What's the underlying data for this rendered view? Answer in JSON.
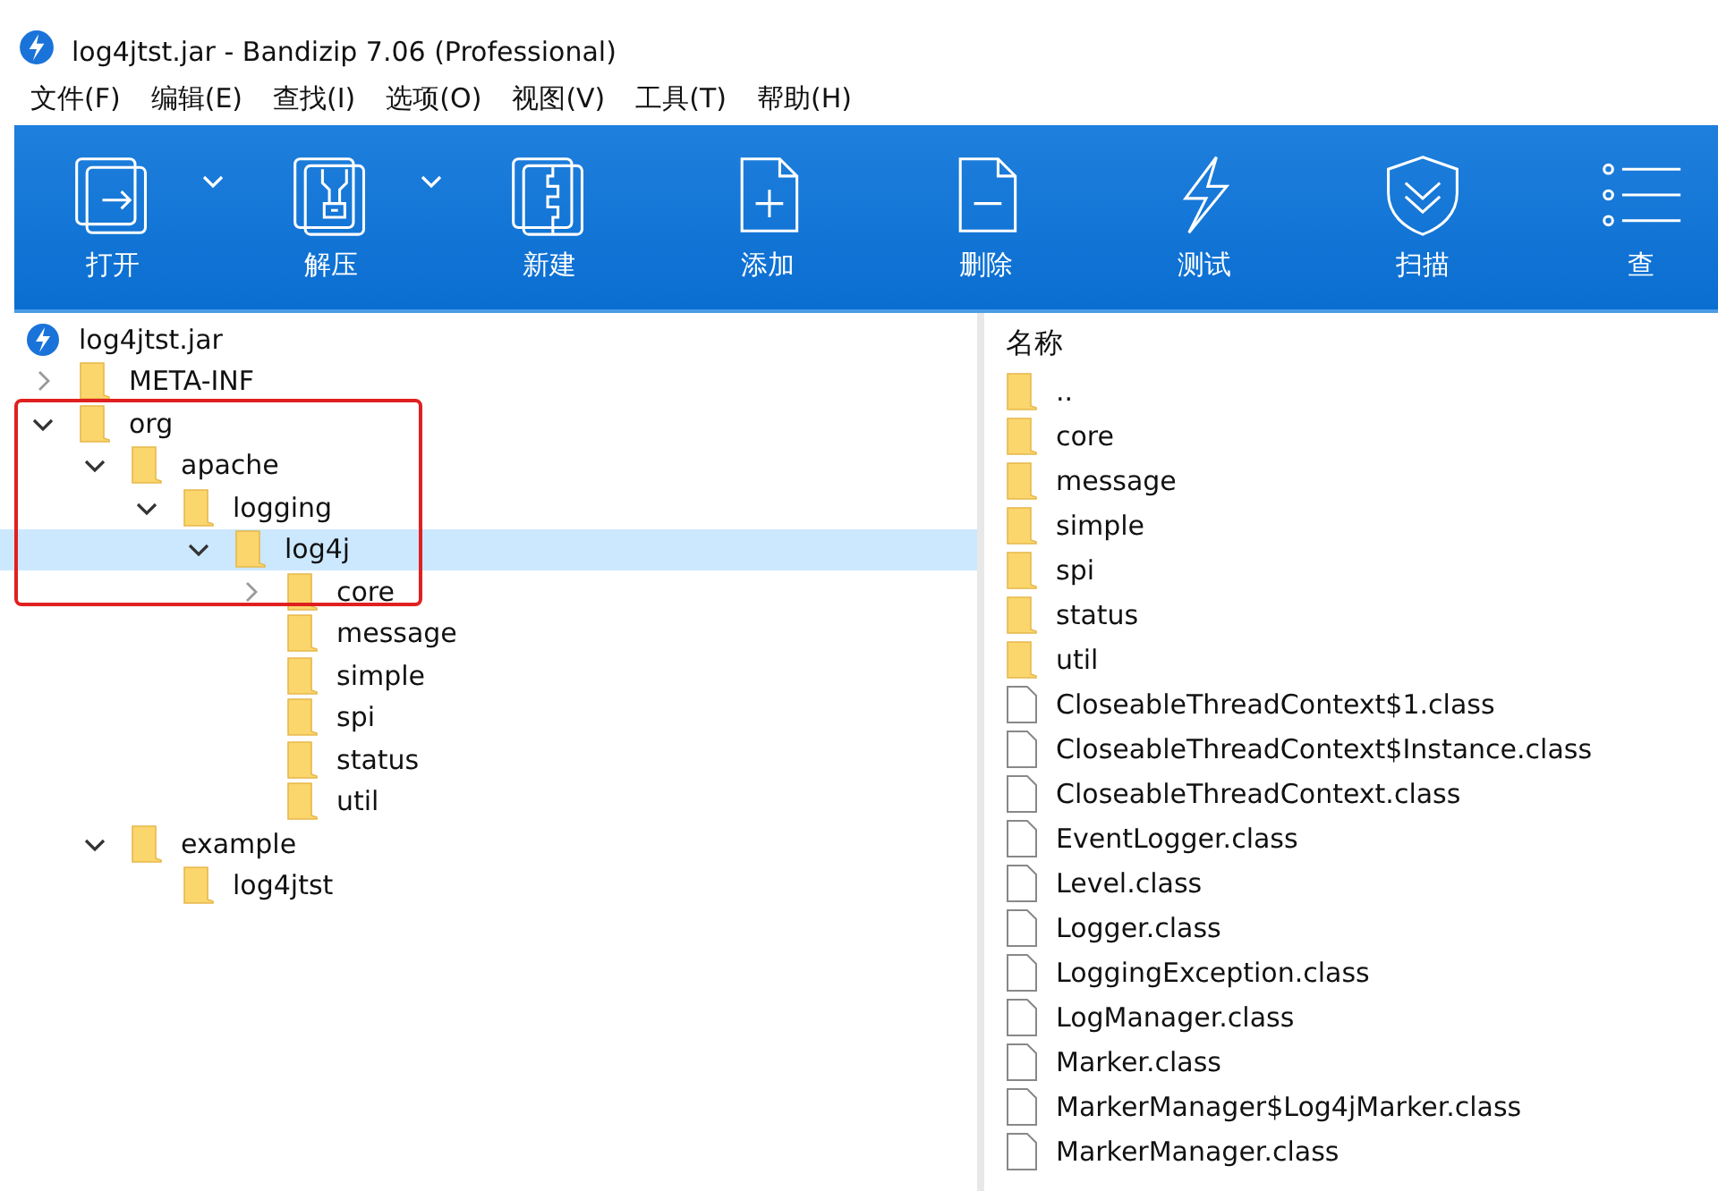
{
  "window": {
    "title": "log4jtst.jar - Bandizip 7.06 (Professional)"
  },
  "menu": [
    "文件(F)",
    "编辑(E)",
    "查找(I)",
    "选项(O)",
    "视图(V)",
    "工具(T)",
    "帮助(H)"
  ],
  "toolbar": [
    {
      "label": "打开",
      "dropdown": true
    },
    {
      "label": "解压",
      "dropdown": true
    },
    {
      "label": "新建",
      "dropdown": false
    },
    {
      "label": "添加",
      "dropdown": false
    },
    {
      "label": "删除",
      "dropdown": false
    },
    {
      "label": "测试",
      "dropdown": false
    },
    {
      "label": "扫描",
      "dropdown": false
    },
    {
      "label": "查",
      "dropdown": false
    }
  ],
  "tree": {
    "root": "log4jtst.jar",
    "items": [
      {
        "name": "META-INF",
        "expanded": false,
        "selected": false
      },
      {
        "name": "org",
        "expanded": true,
        "selected": false,
        "children": [
          {
            "name": "apache",
            "expanded": true,
            "selected": false,
            "children": [
              {
                "name": "logging",
                "expanded": true,
                "selected": false,
                "children": [
                  {
                    "name": "log4j",
                    "expanded": true,
                    "selected": true,
                    "children": [
                      {
                        "name": "core",
                        "expanded": false,
                        "selected": false
                      },
                      {
                        "name": "message",
                        "selected": false
                      },
                      {
                        "name": "simple",
                        "selected": false
                      },
                      {
                        "name": "spi",
                        "selected": false
                      },
                      {
                        "name": "status",
                        "selected": false
                      },
                      {
                        "name": "util",
                        "selected": false
                      }
                    ]
                  }
                ]
              }
            ]
          },
          {
            "name": "example",
            "expanded": true,
            "selected": false,
            "children": [
              {
                "name": "log4jtst",
                "selected": false
              }
            ]
          }
        ]
      }
    ]
  },
  "annotation": {
    "kind": "rectangle"
  },
  "file_list": {
    "column": "名称",
    "items": [
      {
        "name": "..",
        "kind": "folder"
      },
      {
        "name": "core",
        "kind": "folder"
      },
      {
        "name": "message",
        "kind": "folder"
      },
      {
        "name": "simple",
        "kind": "folder"
      },
      {
        "name": "spi",
        "kind": "folder"
      },
      {
        "name": "status",
        "kind": "folder"
      },
      {
        "name": "util",
        "kind": "folder"
      },
      {
        "name": "CloseableThreadContext$1.class",
        "kind": "file"
      },
      {
        "name": "CloseableThreadContext$Instance.class",
        "kind": "file"
      },
      {
        "name": "CloseableThreadContext.class",
        "kind": "file"
      },
      {
        "name": "EventLogger.class",
        "kind": "file"
      },
      {
        "name": "Level.class",
        "kind": "file"
      },
      {
        "name": "Logger.class",
        "kind": "file"
      },
      {
        "name": "LoggingException.class",
        "kind": "file"
      },
      {
        "name": "LogManager.class",
        "kind": "file"
      },
      {
        "name": "Marker.class",
        "kind": "file"
      },
      {
        "name": "MarkerManager$Log4jMarker.class",
        "kind": "file"
      },
      {
        "name": "MarkerManager.class",
        "kind": "file"
      }
    ]
  }
}
